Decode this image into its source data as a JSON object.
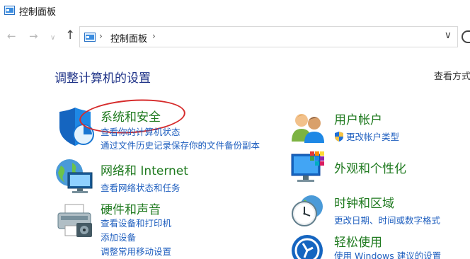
{
  "window": {
    "title": "控制面板"
  },
  "address": {
    "crumb": "控制面板"
  },
  "header": {
    "title": "调整计算机的设置",
    "view_by": "查看方式"
  },
  "categories": {
    "system_security": {
      "title": "系统和安全",
      "links": [
        "查看你的计算机状态",
        "通过文件历史记录保存你的文件备份副本"
      ]
    },
    "network": {
      "title": "网络和 Internet",
      "links": [
        "查看网络状态和任务"
      ]
    },
    "hardware": {
      "title": "硬件和声音",
      "links": [
        "查看设备和打印机",
        "添加设备",
        "调整常用移动设置"
      ]
    },
    "user_accounts": {
      "title": "用户帐户",
      "links": [
        "更改帐户类型"
      ]
    },
    "appearance": {
      "title": "外观和个性化"
    },
    "clock_region": {
      "title": "时钟和区域",
      "links": [
        "更改日期、时间或数字格式"
      ]
    },
    "ease_access": {
      "title": "轻松使用",
      "links": [
        "使用 Windows 建议的设置"
      ]
    }
  }
}
